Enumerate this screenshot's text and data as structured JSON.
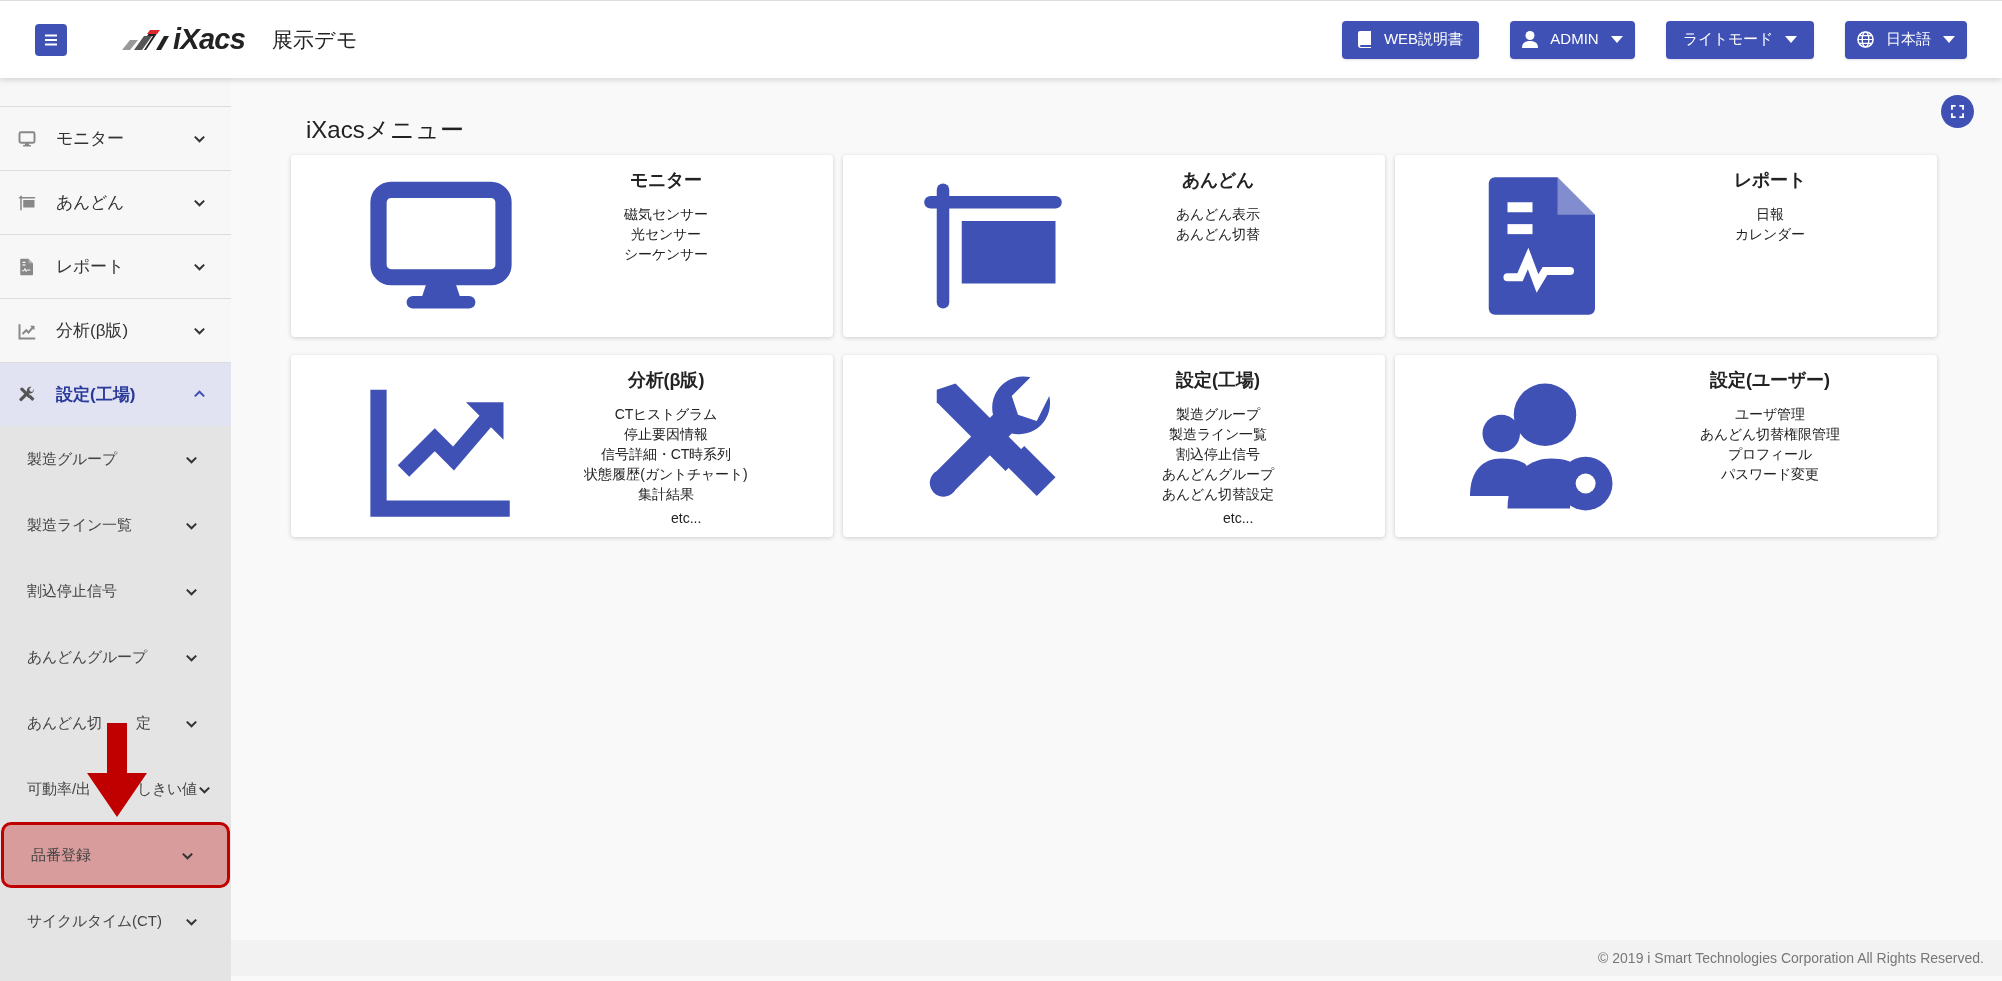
{
  "header": {
    "logo_text": "iXacs",
    "subtitle": "展示デモ",
    "buttons": [
      {
        "kind": "manual",
        "label": "WEB説明書"
      },
      {
        "kind": "user",
        "label": "ADMIN"
      },
      {
        "kind": "mode",
        "label": "ライトモード"
      },
      {
        "kind": "lang",
        "label": "日本語"
      }
    ]
  },
  "sidebar": {
    "items": [
      {
        "kind": "monitor",
        "label": "モニター",
        "expanded": false,
        "selected": false
      },
      {
        "kind": "flag",
        "label": "あんどん",
        "expanded": false,
        "selected": false
      },
      {
        "kind": "doc",
        "label": "レポート",
        "expanded": false,
        "selected": false
      },
      {
        "kind": "chart",
        "label": "分析(β版)",
        "expanded": false,
        "selected": false
      },
      {
        "kind": "tools",
        "label": "設定(工場)",
        "expanded": true,
        "selected": true,
        "children": [
          {
            "parts": [
              "製造グループ"
            ],
            "highlighted": false
          },
          {
            "parts": [
              "製造ライン一覧"
            ],
            "highlighted": false
          },
          {
            "parts": [
              "割込停止信号"
            ],
            "highlighted": false
          },
          {
            "parts": [
              "あんどんグループ"
            ],
            "highlighted": false
          },
          {
            "parts": [
              "あんどん切",
              "定"
            ],
            "highlighted": false
          },
          {
            "parts": [
              "可動率/出",
              "しきい値"
            ],
            "highlighted": false
          },
          {
            "parts": [
              "品番登録"
            ],
            "highlighted": true
          },
          {
            "parts": [
              "サイクルタイム(CT)"
            ],
            "highlighted": false
          }
        ]
      }
    ]
  },
  "main": {
    "title": "iXacsメニュー",
    "cards": [
      {
        "kind": "monitor",
        "title": "モニター",
        "items": [
          "磁気センサー",
          "光センサー",
          "シーケンサー"
        ]
      },
      {
        "kind": "flag",
        "title": "あんどん",
        "items": [
          "あんどん表示",
          "あんどん切替"
        ]
      },
      {
        "kind": "doc",
        "title": "レポート",
        "items": [
          "日報",
          "カレンダー"
        ]
      },
      {
        "kind": "chart",
        "title": "分析(β版)",
        "items": [
          "CTヒストグラム",
          "停止要因情報",
          "信号詳細・CT時系列",
          "状態履歴(ガントチャート)",
          "集計結果"
        ],
        "more": "etc..."
      },
      {
        "kind": "tools",
        "title": "設定(工場)",
        "items": [
          "製造グループ",
          "製造ライン一覧",
          "割込停止信号",
          "あんどんグループ",
          "あんどん切替設定"
        ],
        "more": "etc..."
      },
      {
        "kind": "users",
        "title": "設定(ユーザー)",
        "items": [
          "ユーザ管理",
          "あんどん切替権限管理",
          "プロフィール",
          "パスワード変更"
        ]
      }
    ]
  },
  "footer": "© 2019 i Smart Technologies Corporation All Rights Reserved."
}
